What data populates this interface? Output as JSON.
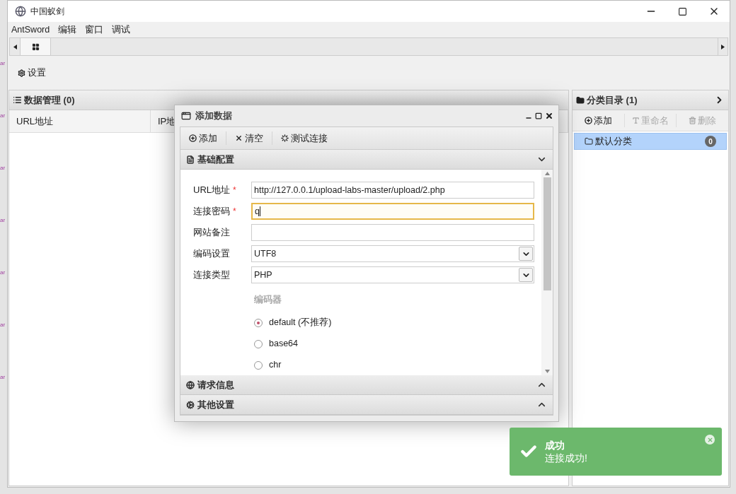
{
  "background_fragments": [
    "ar",
    "ar",
    "ar",
    "ar",
    "ar",
    "ar",
    "ar"
  ],
  "window": {
    "title": "中国蚁剑"
  },
  "menu": [
    "AntSword",
    "编辑",
    "窗口",
    "调试"
  ],
  "toolbar": [
    "设置"
  ],
  "data_panel": {
    "title": "数据管理 (0)",
    "columns": [
      "URL地址",
      "IP地"
    ]
  },
  "category_panel": {
    "title": "分类目录 (1)",
    "buttons": [
      {
        "label": "添加",
        "disabled": false
      },
      {
        "label": "重命名",
        "disabled": true
      },
      {
        "label": "删除",
        "disabled": true
      }
    ],
    "items": [
      {
        "label": "默认分类",
        "count": "0",
        "selected": true
      }
    ]
  },
  "dialog": {
    "title": "添加数据",
    "toolbar": [
      "添加",
      "清空",
      "测试连接"
    ],
    "sections": [
      {
        "title": "基础配置",
        "expanded": true
      },
      {
        "title": "请求信息",
        "expanded": false
      },
      {
        "title": "其他设置",
        "expanded": false
      }
    ],
    "fields": [
      {
        "kind": "text",
        "label": "URL地址",
        "required_mark": "*",
        "focused": false,
        "value": "http://127.0.0.1/upload-labs-master/upload/2.php"
      },
      {
        "kind": "text",
        "label": "连接密码",
        "required_mark": "*",
        "focused": true,
        "value": "q"
      },
      {
        "kind": "text",
        "label": "网站备注",
        "focused": false
      },
      {
        "kind": "select",
        "label": "编码设置",
        "value": "UTF8"
      },
      {
        "kind": "select",
        "label": "连接类型",
        "value": "PHP"
      }
    ],
    "encoder": {
      "label": "编码器",
      "options": [
        {
          "label": "default (不推荐)",
          "selected": true
        },
        {
          "label": "base64",
          "selected": false
        },
        {
          "label": "chr",
          "selected": false
        }
      ]
    }
  },
  "toast": {
    "title": "成功",
    "message": "连接成功!"
  }
}
